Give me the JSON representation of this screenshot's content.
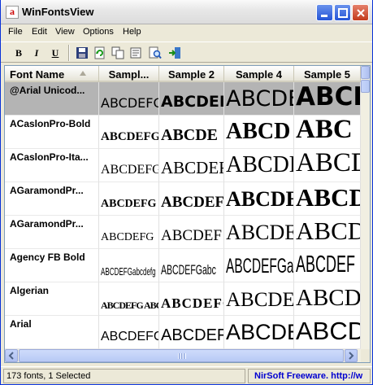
{
  "window": {
    "title": "WinFontsView"
  },
  "menu": {
    "items": [
      "File",
      "Edit",
      "View",
      "Options",
      "Help"
    ]
  },
  "toolbar": {
    "bold_label": "B",
    "italic_label": "I",
    "underline_label": "U"
  },
  "columns": [
    "Font Name",
    "Sampl...",
    "Sample 2",
    "Sample 4",
    "Sample 5"
  ],
  "rows": [
    {
      "name": "@Arial Unicod...",
      "s1": "ABCDEFG",
      "s2": "ABCDEF",
      "s4": "ABCDE",
      "s5": "ABCD",
      "selected": true
    },
    {
      "name": "ACaslonPro-Bold",
      "s1": "ABCDEFG",
      "s2": "ABCDE",
      "s4": "ABCD",
      "s5": "ABC"
    },
    {
      "name": "ACaslonPro-Ita...",
      "s1": "ABCDEFG",
      "s2": "ABCDEF",
      "s4": "ABCDE",
      "s5": "ABCD"
    },
    {
      "name": "AGaramondPr...",
      "s1": "ABCDEFG",
      "s2": "ABCDEF",
      "s4": "ABCDE",
      "s5": "ABCD"
    },
    {
      "name": "AGaramondPr...",
      "s1": "ABCDEFG",
      "s2": "ABCDEF",
      "s4": "ABCDE",
      "s5": "ABCD"
    },
    {
      "name": "Agency FB Bold",
      "s1": "ABCDEFGabcdefg",
      "s2": "ABCDEFGabc",
      "s4": "ABCDEFGa",
      "s5": "ABCDEF"
    },
    {
      "name": "Algerian",
      "s1": "ABCDEFG ABCDEFG",
      "s2": "ABCDEFG",
      "s4": "ABCDE",
      "s5": "ABCD"
    },
    {
      "name": "Arial",
      "s1": "ABCDEFG",
      "s2": "ABCDEF",
      "s4": "ABCDE",
      "s5": "ABCD"
    }
  ],
  "status": {
    "count": "173 fonts, 1 Selected",
    "brand": "NirSoft Freeware.  http://w"
  }
}
